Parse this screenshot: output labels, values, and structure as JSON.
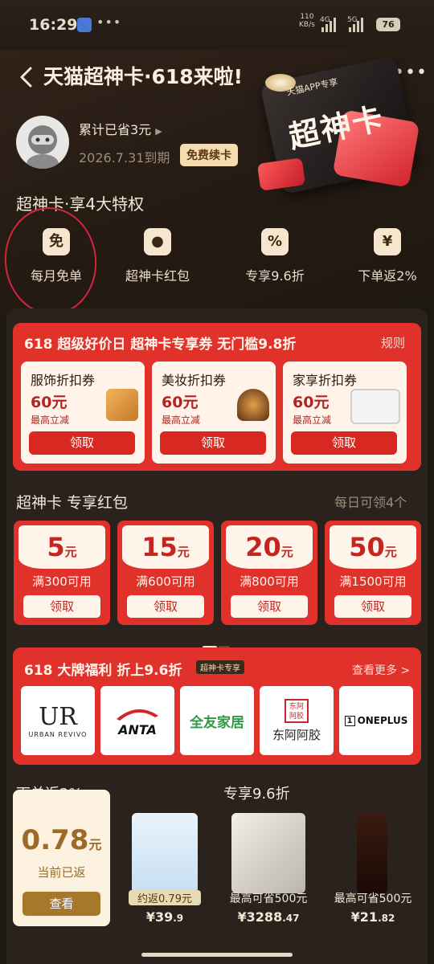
{
  "status_bar": {
    "time": "16:29",
    "net_speed": "110",
    "net_unit": "KB/s",
    "sig1": "4G",
    "sig2": "5G",
    "battery": "76"
  },
  "header": {
    "title": "天猫超神卡·618来啦!",
    "card_badge": "天猫APP专享",
    "card_name": "超神卡",
    "saved_text": "累计已省3元",
    "expire_text": "2026.7.31到期",
    "renew_label": "免费续卡"
  },
  "perks": {
    "title": "超神卡·享4大特权",
    "items": [
      {
        "icon": "免",
        "label": "每月免单"
      },
      {
        "icon": "●",
        "label": "超神卡红包"
      },
      {
        "icon": "%",
        "label": "专享9.6折"
      },
      {
        "icon": "¥",
        "label": "下单返2%"
      }
    ]
  },
  "coupons": {
    "heading": "618 超级好价日 超神卡专享券 无门槛9.8折",
    "rules": "规则",
    "items": [
      {
        "name": "服饰折扣券",
        "amount": "60元",
        "sub": "最高立减",
        "button": "领取"
      },
      {
        "name": "美妆折扣券",
        "amount": "60元",
        "sub": "最高立减",
        "button": "领取"
      },
      {
        "name": "家享折扣券",
        "amount": "60元",
        "sub": "最高立减",
        "button": "领取"
      }
    ]
  },
  "red_packets": {
    "title": "超神卡 专享红包",
    "note": "每日可领4个",
    "items": [
      {
        "value": "5",
        "unit": "元",
        "cond": "满300可用",
        "button": "领取"
      },
      {
        "value": "15",
        "unit": "元",
        "cond": "满600可用",
        "button": "领取"
      },
      {
        "value": "20",
        "unit": "元",
        "cond": "满800可用",
        "button": "领取"
      },
      {
        "value": "50",
        "unit": "元",
        "cond": "满1500可用",
        "button": "领取"
      }
    ]
  },
  "brands": {
    "heading": "618 大牌福利 折上9.6折",
    "tag": "超神卡专享",
    "more": "查看更多 >",
    "items": [
      "URBAN REVIVO",
      "ANTA",
      "全友家居",
      "东阿阿胶",
      "ONEPLUS"
    ],
    "ur_mark": "UR",
    "dongge_seal": "东阿阿胶"
  },
  "cashback": {
    "title": "下单返2%",
    "amount": "0.78",
    "unit": "元",
    "label": "当前已返",
    "button": "查看"
  },
  "discount": {
    "title": "专享9.6折",
    "products": [
      {
        "label": "约返0.79元",
        "price": "¥39",
        "cents": ".9"
      },
      {
        "label": "最高可省500元",
        "price": "¥3288",
        "cents": ".47"
      },
      {
        "label": "最高可省500元",
        "price": "¥21",
        "cents": ".82"
      }
    ]
  },
  "colors": {
    "bg": "#1e1812",
    "red": "#e0312b",
    "gold": "#f5dcae",
    "cream": "#fff3ea"
  }
}
